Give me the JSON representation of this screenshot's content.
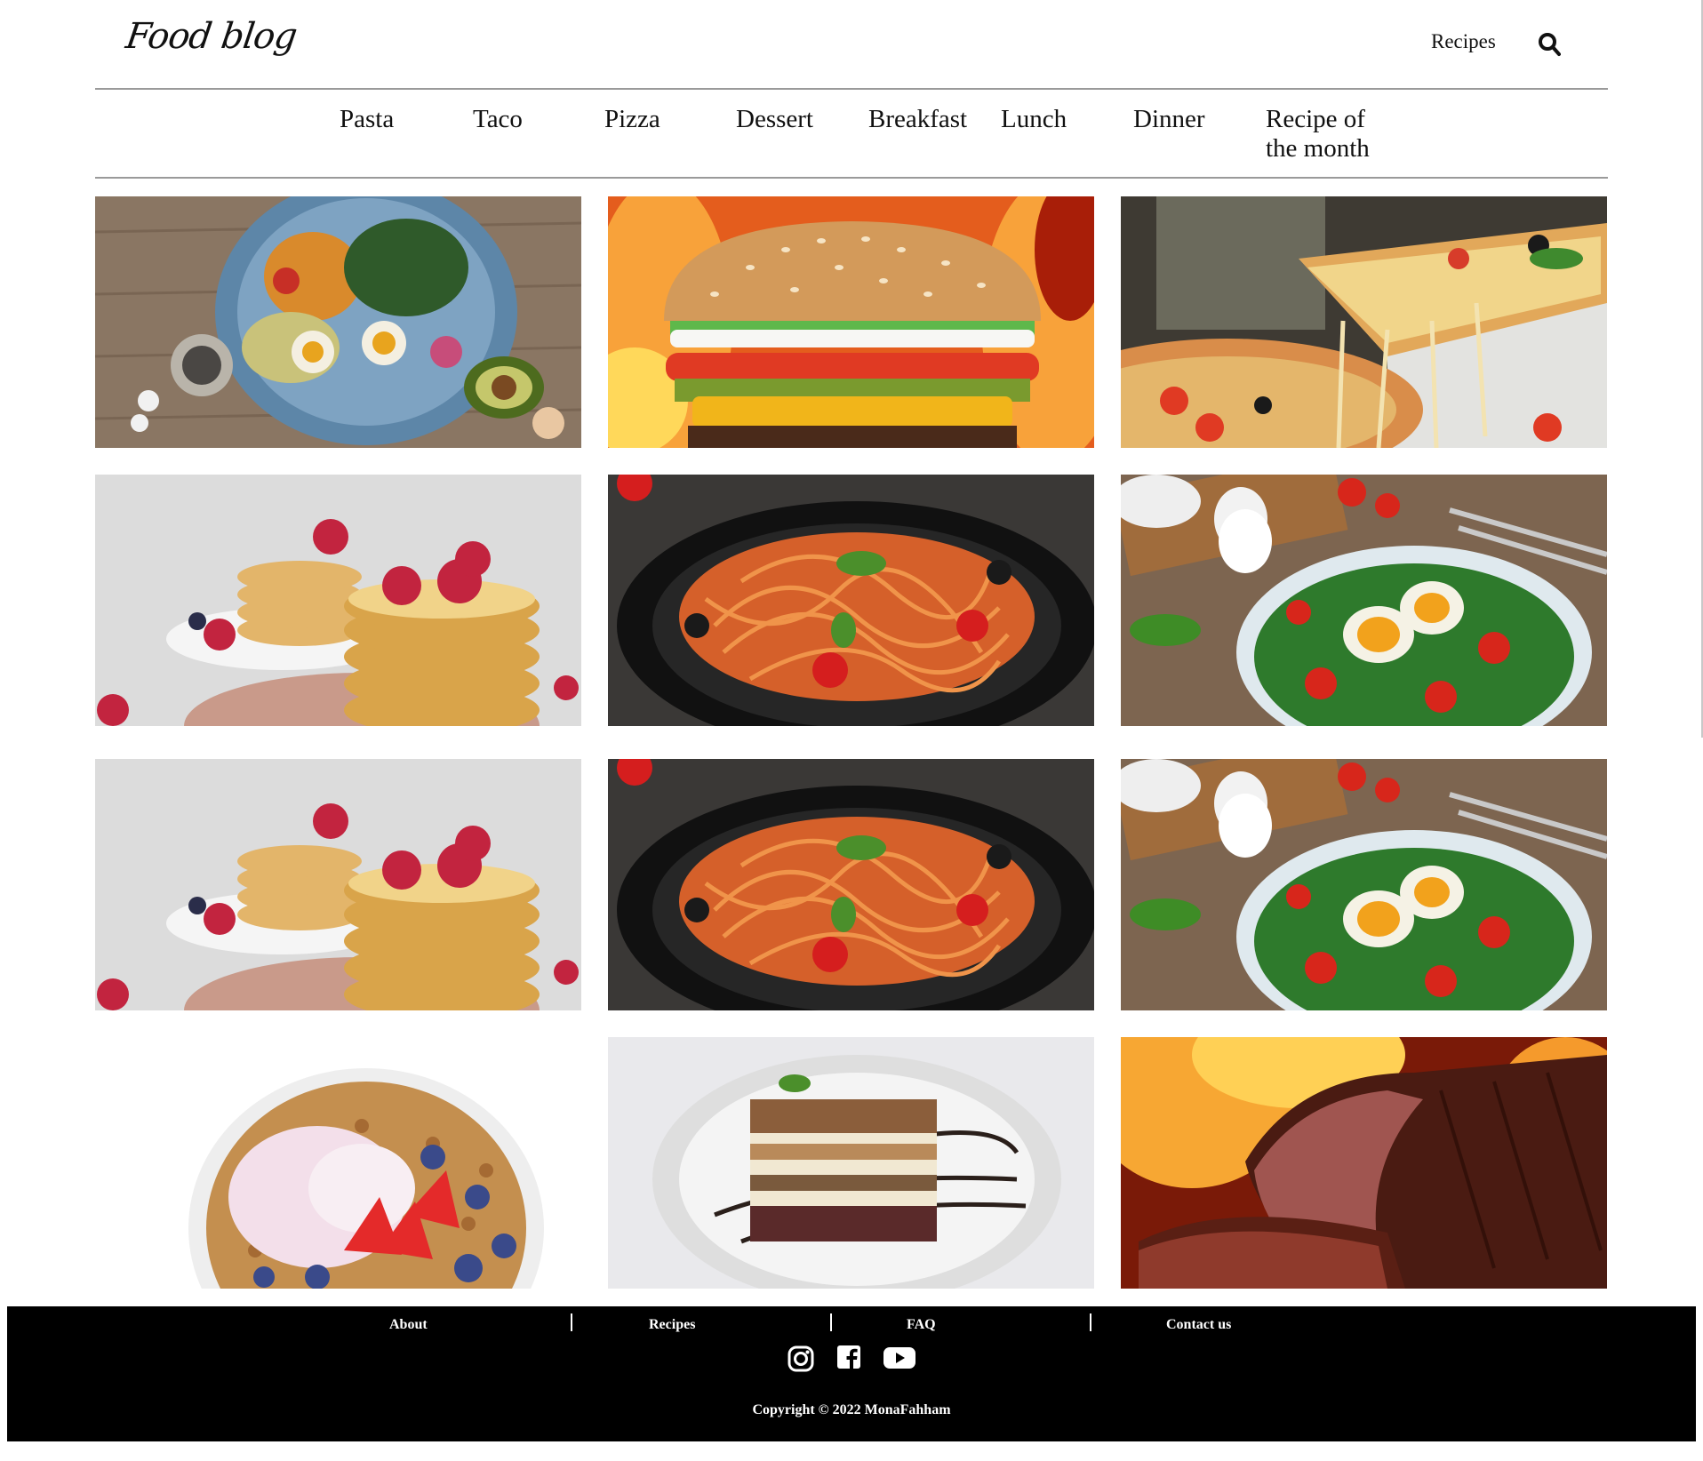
{
  "header": {
    "logo": "Food blog",
    "recipes_link": "Recipes"
  },
  "nav": {
    "items": [
      {
        "label": "Pasta"
      },
      {
        "label": "Taco"
      },
      {
        "label": "Pizza"
      },
      {
        "label": "Dessert"
      },
      {
        "label": "Breakfast"
      },
      {
        "label": "Lunch"
      },
      {
        "label": "Dinner"
      },
      {
        "label": "Recipe of the month"
      }
    ]
  },
  "gallery": [
    {
      "name": "salad-bowl"
    },
    {
      "name": "burger"
    },
    {
      "name": "pizza-slice"
    },
    {
      "name": "pancakes"
    },
    {
      "name": "spaghetti"
    },
    {
      "name": "egg-salad"
    },
    {
      "name": "pancakes"
    },
    {
      "name": "spaghetti"
    },
    {
      "name": "egg-salad"
    },
    {
      "name": "yogurt-granola"
    },
    {
      "name": "tiramisu-cake"
    },
    {
      "name": "roast-beef"
    }
  ],
  "footer": {
    "links": [
      "About",
      "Recipes",
      "FAQ",
      "Contact us"
    ],
    "social": [
      "instagram-icon",
      "facebook-icon",
      "youtube-icon"
    ],
    "copyright": "Copyright © 2022 MonaFahham"
  },
  "colors": {
    "footer_bg": "#000000",
    "rule": "#9a9a9a"
  }
}
